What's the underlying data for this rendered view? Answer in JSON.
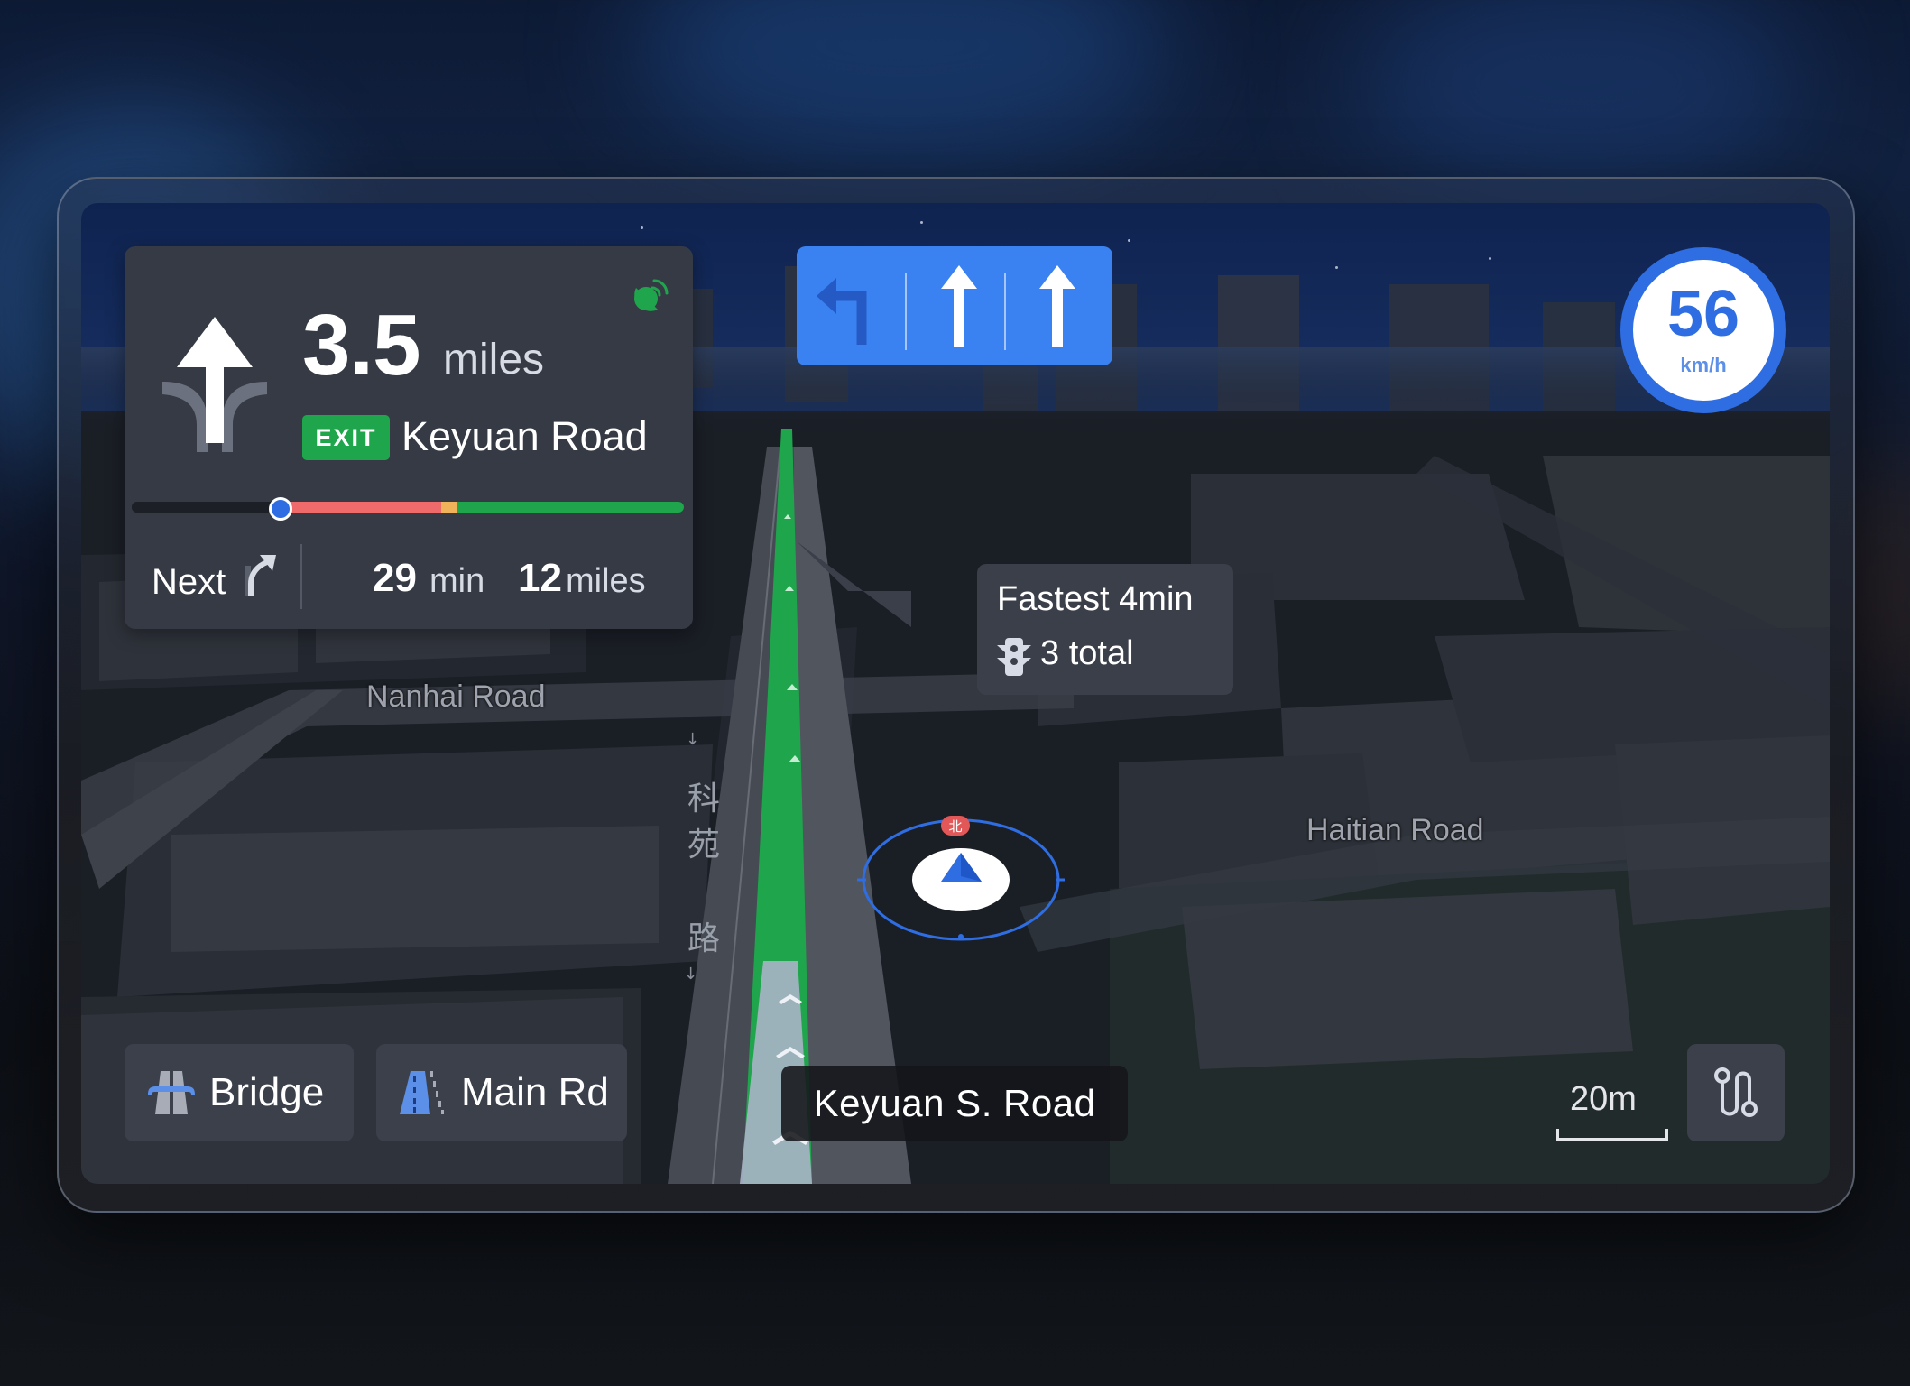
{
  "navigation": {
    "maneuver": {
      "icon": "straight-arrow-icon",
      "distance_value": "3.5",
      "distance_unit": "miles"
    },
    "exit_badge": "EXIT",
    "exit_road": "Keyuan Road",
    "gps_status_icon": "gps-signal-icon",
    "progress": {
      "current_fraction": 0.27,
      "segments": [
        {
          "status": "traveled",
          "start": 0.0,
          "end": 0.27,
          "color": "#1c1f25"
        },
        {
          "status": "heavy-traffic",
          "start": 0.27,
          "end": 0.56,
          "color": "#ef6b6b"
        },
        {
          "status": "slow-traffic",
          "start": 0.56,
          "end": 0.59,
          "color": "#f0b35a"
        },
        {
          "status": "clear",
          "start": 0.59,
          "end": 1.0,
          "color": "#1fa64c"
        }
      ]
    },
    "next": {
      "label": "Next",
      "icon": "turn-slight-right-icon"
    },
    "eta": {
      "time_value": "29",
      "time_unit": "min",
      "distance_value": "12",
      "distance_unit": "miles"
    }
  },
  "lane_guidance": [
    {
      "direction": "left-turn",
      "icon": "turn-left-arrow-icon",
      "recommended": false
    },
    {
      "direction": "straight",
      "icon": "straight-arrow-icon",
      "recommended": true
    },
    {
      "direction": "straight",
      "icon": "straight-arrow-icon",
      "recommended": true
    }
  ],
  "speed": {
    "value": "56",
    "unit": "km/h"
  },
  "route_tooltip": {
    "title": "Fastest 4min",
    "traffic_lights": "3 total",
    "icon": "traffic-light-icon"
  },
  "map_labels": {
    "nanhai": "Nanhai Road",
    "haitian": "Haitian Road",
    "keyuan_cn": [
      "科",
      "苑",
      "路"
    ],
    "north_badge": "北"
  },
  "bottom_bar": {
    "road_options": [
      {
        "label": "Bridge",
        "icon": "bridge-icon"
      },
      {
        "label": "Main Rd",
        "icon": "main-road-icon"
      }
    ],
    "current_road": "Keyuan S. Road",
    "scale": "20m",
    "route_overview_icon": "route-overview-icon"
  },
  "colors": {
    "accent_blue": "#2f6de2",
    "lane_blue": "#3a82f2",
    "route_green": "#1fa64c",
    "traffic_red": "#ef6b6b",
    "traffic_amber": "#f0b35a"
  }
}
